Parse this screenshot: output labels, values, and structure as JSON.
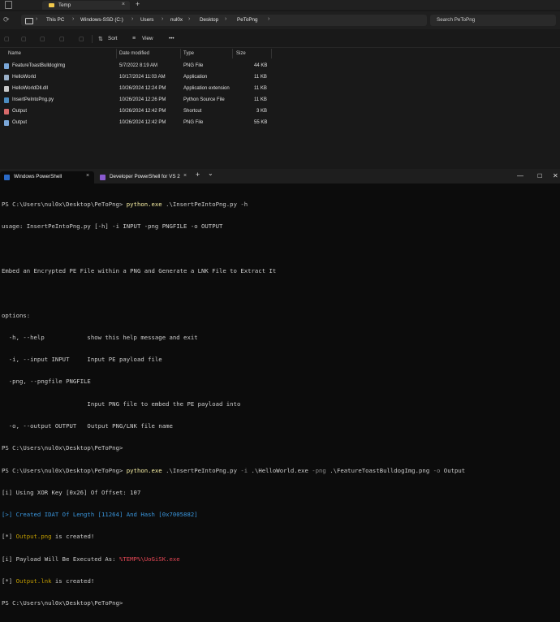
{
  "explorer": {
    "tab_title": "Temp",
    "tab_close": "×",
    "new_tab": "+",
    "nav": {
      "back": "←",
      "forward": "→",
      "up": "↑",
      "refresh": "⟳"
    },
    "breadcrumbs": [
      "This PC",
      "Windows-SSD (C:)",
      "Users",
      "nul0x",
      "Desktop",
      "PeToPng"
    ],
    "breadcrumb_sep": "›",
    "search_placeholder": "Search PeToPng",
    "commands": {
      "sort": "Sort",
      "view": "View",
      "more": "•••"
    },
    "columns": [
      "Name",
      "Date modified",
      "Type",
      "Size"
    ],
    "files": [
      {
        "name": "FeatureToastBulldogImg",
        "date": "5/7/2022 8:19 AM",
        "type": "PNG File",
        "size": "44 KB",
        "icon_color": "#7aa7d8"
      },
      {
        "name": "HelloWorld",
        "date": "10/17/2024 11:03 AM",
        "type": "Application",
        "size": "11 KB",
        "icon_color": "#9ab0c8"
      },
      {
        "name": "HelloWorldDll.dll",
        "date": "10/26/2024 12:24 PM",
        "type": "Application extension",
        "size": "11 KB",
        "icon_color": "#c8c8c8"
      },
      {
        "name": "InsertPeIntoPng.py",
        "date": "10/26/2024 12:26 PM",
        "type": "Python Source File",
        "size": "11 KB",
        "icon_color": "#4b8bbe"
      },
      {
        "name": "Output",
        "date": "10/26/2024 12:42 PM",
        "type": "Shortcut",
        "size": "3 KB",
        "icon_color": "#d86a6a"
      },
      {
        "name": "Output",
        "date": "10/26/2024 12:42 PM",
        "type": "PNG File",
        "size": "55 KB",
        "icon_color": "#7aa7d8"
      }
    ]
  },
  "terminal": {
    "tabs": [
      {
        "label": "Windows PowerShell",
        "close": "×"
      },
      {
        "label": "Developer PowerShell for VS 2",
        "close": "×"
      }
    ],
    "new_tab": "+",
    "dropdown": "⌄",
    "window_controls": {
      "minimize": "—",
      "maximize": "☐",
      "close": "✕"
    },
    "lines": {
      "l1_prompt": "PS C:\\Users\\nul0x\\Desktop\\PeToPng> ",
      "l1_cmd": "python.exe",
      "l1_args": " .\\InsertPeIntoPng.py -h",
      "l2": "usage: InsertPeIntoPng.py [-h] -i INPUT -png PNGFILE -o OUTPUT",
      "l3": "",
      "l4": "Embed an Encrypted PE File within a PNG and Generate a LNK File to Extract It",
      "l5": "",
      "l6": "options:",
      "l7": "  -h, --help            show this help message and exit",
      "l8": "  -i, --input INPUT     Input PE payload file",
      "l9": "  -png, --pngfile PNGFILE",
      "l10": "                        Input PNG file to embed the PE payload into",
      "l11": "  -o, --output OUTPUT   Output PNG/LNK file name",
      "l12": "PS C:\\Users\\nul0x\\Desktop\\PeToPng> ",
      "l13_prompt": "PS C:\\Users\\nul0x\\Desktop\\PeToPng> ",
      "l13_cmd": "python.exe",
      "l13_args_a": " .\\InsertPeIntoPng.py ",
      "l13_flag_i": "-i",
      "l13_args_b": " .\\HelloWorld.exe ",
      "l13_flag_png": "-png",
      "l13_args_c": " .\\FeatureToastBulldogImg.png ",
      "l13_flag_o": "-o",
      "l13_args_d": " Output",
      "l14": "[i] Using XOR Key [0x26] Of Offset: 107",
      "l15": "[>] Created IDAT Of Length [11264] And Hash [0x7005882]",
      "l16_tag": "[*] ",
      "l16_name": "Output.png",
      "l16_rest": " is created!",
      "l17_text": "[i] Payload Will Be Executed As: ",
      "l17_path": "%TEMP%\\UoGiSK.exe",
      "l18_tag": "[*] ",
      "l18_name": "Output.lnk",
      "l18_rest": " is created!",
      "l19": "PS C:\\Users\\nul0x\\Desktop\\PeToPng> "
    }
  }
}
